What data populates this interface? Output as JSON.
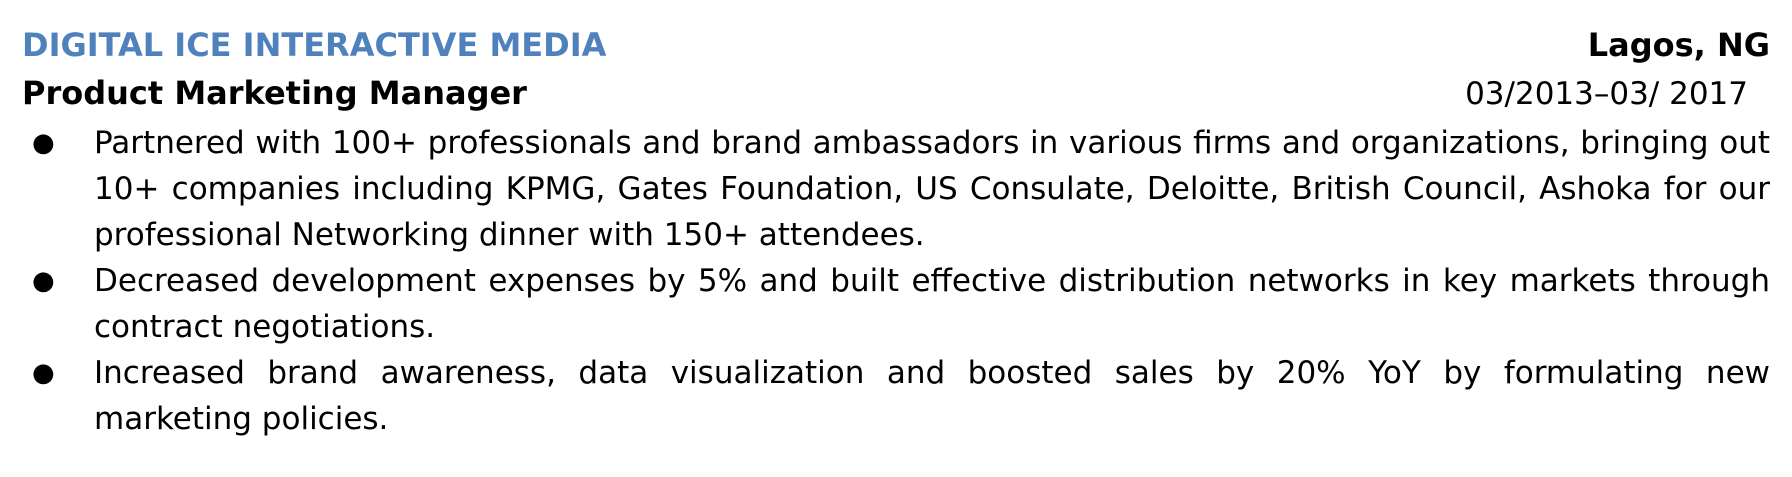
{
  "experience": {
    "company": "DIGITAL ICE INTERACTIVE MEDIA",
    "location": "Lagos, NG",
    "title": "Product Marketing Manager",
    "dates": "03/2013–03/ 2017",
    "bullet_symbol": "●",
    "bullets": [
      "Partnered with 100+ professionals and brand ambassadors in various firms and organizations, bringing out 10+ companies including KPMG, Gates Foundation, US Consulate, Deloitte, British Council, Ashoka for our professional Networking dinner with 150+ attendees.",
      "Decreased development expenses by 5% and built effective distribution networks in key markets through contract negotiations.",
      "Increased brand awareness, data visualization and boosted sales by 20% YoY by formulating new marketing policies."
    ]
  },
  "colors": {
    "company": "#4f81bd",
    "text": "#000000",
    "background": "#ffffff"
  }
}
